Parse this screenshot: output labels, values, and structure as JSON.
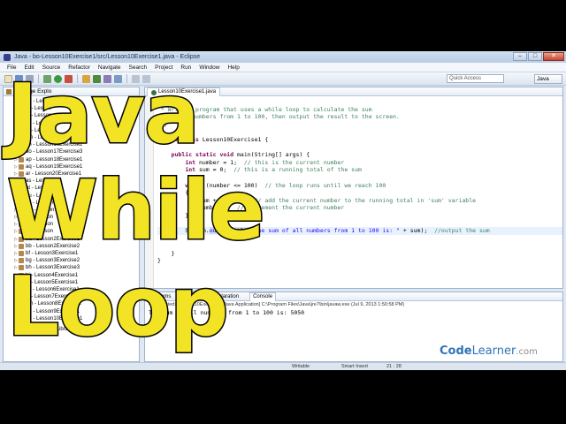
{
  "window": {
    "title": "Java - bo-Lesson10Exercise1/src/Lesson10Exercise1.java - Eclipse",
    "controls": [
      "–",
      "□",
      "✕"
    ]
  },
  "menu": [
    "File",
    "Edit",
    "Source",
    "Refactor",
    "Navigate",
    "Search",
    "Project",
    "Run",
    "Window",
    "Help"
  ],
  "toolbar": {
    "quick_access": "Quick Access",
    "perspective": "Java"
  },
  "package_explorer": {
    "title": "Package Explo",
    "items": [
      "ah - Lesson",
      "ai - Lesson",
      "aj - Lesson",
      "ak - Lesson",
      "al - Lesson",
      "am - Lesson",
      "an - Lesson16Exercise2",
      "ao - Lesson17Exercise3",
      "ap - Lesson18Exercise1",
      "aq - Lesson19Exercise1",
      "ar - Lesson20Exercise1",
      "as - Lesson",
      "at - Lesson",
      "au - Lesson",
      "av - Lesson",
      "aw - Lesson",
      "ax - Lesson",
      "ay - Lesson",
      "az - Lesson",
      "ba - Lesson2Exercise1",
      "bb - Lesson2Exercise2",
      "bf - Lesson3Exercise1",
      "bg - Lesson3Exercise2",
      "bh - Lesson3Exercise3",
      "bi - Lesson4Exercise1",
      "bj - Lesson5Exercise1",
      "bk - Lesson6Exercise1",
      "bl - Lesson7Exercise1",
      "bm - Lesson8Exercise1",
      "bn - Lesson9Exercise1",
      "bo - Lesson10Exercise1"
    ],
    "jre": "JRE System Library [JavaSE-1.7]"
  },
  "editor": {
    "tab": "Lesson10Exercise1.java",
    "lines": [
      [
        {
          "t": "/*",
          "c": "c-comment"
        }
      ],
      [
        {
          "t": " * Write a program that uses a while loop to calculate the sum",
          "c": "c-comment"
        }
      ],
      [
        {
          "t": " * of the numbers from 1 to 100, then output the result to the screen.",
          "c": "c-comment"
        }
      ],
      [
        {
          "t": " */",
          "c": "c-comment"
        }
      ],
      [
        {
          "t": "",
          "c": ""
        }
      ],
      [
        {
          "t": "public class ",
          "c": "c-kw"
        },
        {
          "t": "Lesson10Exercise1 {",
          "c": ""
        }
      ],
      [
        {
          "t": "",
          "c": ""
        }
      ],
      [
        {
          "t": "    ",
          "c": ""
        },
        {
          "t": "public static void ",
          "c": "c-kw"
        },
        {
          "t": "main(String[] args) {",
          "c": ""
        }
      ],
      [
        {
          "t": "        ",
          "c": ""
        },
        {
          "t": "int ",
          "c": "c-kw"
        },
        {
          "t": "number = 1;  ",
          "c": ""
        },
        {
          "t": "// this is the current number",
          "c": "c-comment"
        }
      ],
      [
        {
          "t": "        ",
          "c": ""
        },
        {
          "t": "int ",
          "c": "c-kw"
        },
        {
          "t": "sum = 0;  ",
          "c": ""
        },
        {
          "t": "// this is a running total of the sum",
          "c": "c-comment"
        }
      ],
      [
        {
          "t": "",
          "c": ""
        }
      ],
      [
        {
          "t": "        ",
          "c": ""
        },
        {
          "t": "while ",
          "c": "c-kw"
        },
        {
          "t": "(number <= 100)  ",
          "c": ""
        },
        {
          "t": "// the loop runs until we reach 100",
          "c": "c-comment"
        }
      ],
      [
        {
          "t": "        {",
          "c": ""
        }
      ],
      [
        {
          "t": "            sum += number;  ",
          "c": ""
        },
        {
          "t": "// add the current number to the running total in 'sum' variable",
          "c": "c-comment"
        }
      ],
      [
        {
          "t": "            number++;  ",
          "c": ""
        },
        {
          "t": "// increment the current number",
          "c": "c-comment"
        }
      ],
      [
        {
          "t": "        }",
          "c": ""
        }
      ],
      [
        {
          "t": "",
          "c": ""
        }
      ],
      [
        {
          "t": "        System.",
          "c": ""
        },
        {
          "t": "out",
          "c": "c-field c-hl"
        },
        {
          "t": ".println(",
          "c": "c-hl"
        },
        {
          "t": "\"The sum of all numbers from 1 to 100 is: \"",
          "c": "c-str"
        },
        {
          "t": " + sum);  ",
          "c": ""
        },
        {
          "t": "//output the sum",
          "c": "c-comment"
        }
      ],
      [
        {
          "t": "",
          "c": ""
        }
      ],
      [
        {
          "t": "",
          "c": ""
        }
      ],
      [
        {
          "t": "    }",
          "c": ""
        }
      ],
      [
        {
          "t": "}",
          "c": ""
        }
      ]
    ]
  },
  "console": {
    "tabs": [
      "Problems",
      "Javadoc",
      "Declaration",
      "Console"
    ],
    "header": "<terminated> Lesson10Exercise1 [Java Application] C:\\Program Files\\Java\\jre7\\bin\\javaw.exe (Jul 9, 2013 1:50:58 PM)",
    "output": "The sum of all numbers from 1 to 100 is: 5050"
  },
  "statusbar": {
    "writable": "Writable",
    "insert_mode": "Smart Insert",
    "position": "21 : 28"
  },
  "overlay": {
    "word1": "Java",
    "word2": "While",
    "word3": "Loop"
  },
  "logo": {
    "code": "Code",
    "learner": "Learner",
    "com": ".com"
  },
  "colors": {
    "overlay_text": "#f2e425",
    "logo_blue": "#2e75b6",
    "window_bg": "#dfe8f3",
    "keyword": "#7f0055",
    "comment": "#3f7f5f",
    "string": "#2a00ff"
  }
}
